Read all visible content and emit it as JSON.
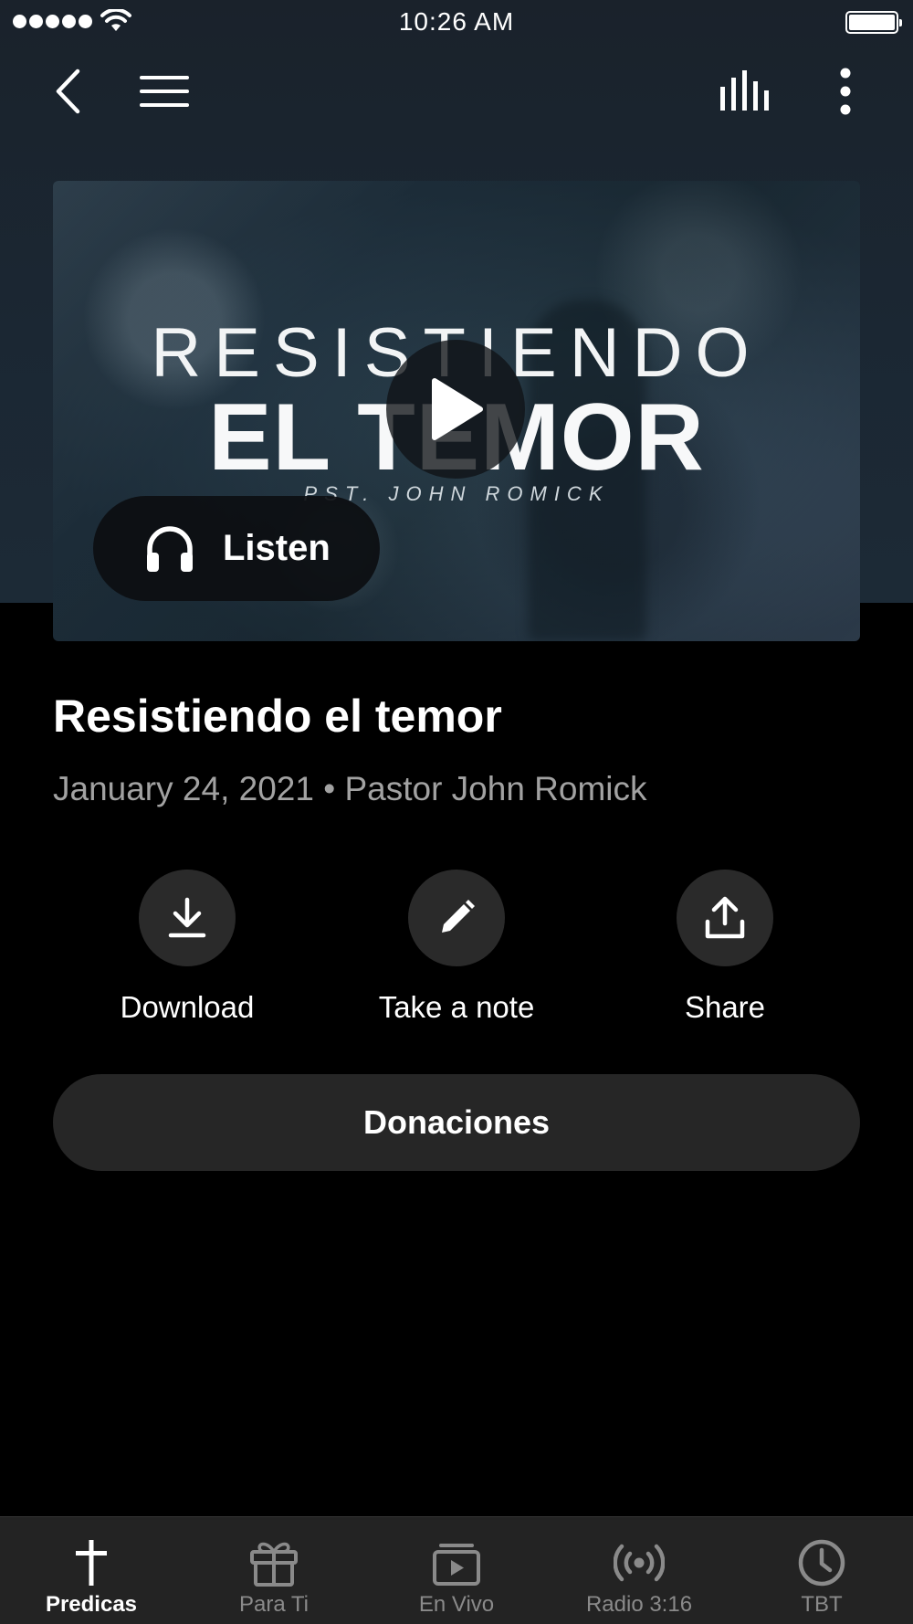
{
  "status_bar": {
    "time": "10:26 AM"
  },
  "hero": {
    "line1": "RESISTIENDO",
    "line2": "EL TEMOR",
    "line3": "PST. JOHN ROMICK",
    "listen_label": "Listen"
  },
  "sermon": {
    "title": "Resistiendo el temor",
    "meta": "January 24, 2021 • Pastor John Romick"
  },
  "actions": {
    "download": "Download",
    "note": "Take a note",
    "share": "Share"
  },
  "donate_label": "Donaciones",
  "tabs": [
    {
      "label": "Predicas",
      "icon": "cross-icon",
      "active": true
    },
    {
      "label": "Para Ti",
      "icon": "gift-icon",
      "active": false
    },
    {
      "label": "En Vivo",
      "icon": "live-video-icon",
      "active": false
    },
    {
      "label": "Radio 3:16",
      "icon": "broadcast-icon",
      "active": false
    },
    {
      "label": "TBT",
      "icon": "clock-icon",
      "active": false
    }
  ],
  "colors": {
    "background": "#000000",
    "header_background": "#1b2733",
    "surface": "#262626",
    "muted_text": "#a2a2a2",
    "inactive_tab": "#8a8a8a"
  }
}
